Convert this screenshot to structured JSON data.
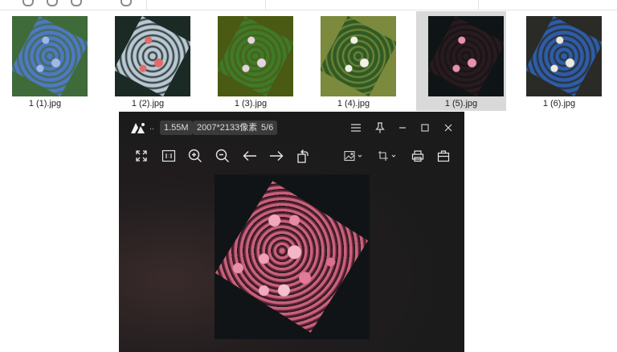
{
  "explorer": {
    "files": [
      {
        "name": "1 (1).jpg",
        "selected": false,
        "colors": [
          "#3f6b3a",
          "#4f78c4",
          "#9fb8e8"
        ]
      },
      {
        "name": "1 (2).jpg",
        "selected": false,
        "colors": [
          "#1c2a26",
          "#b9c8d3",
          "#e46b6b"
        ]
      },
      {
        "name": "1 (3).jpg",
        "selected": false,
        "colors": [
          "#4a5a12",
          "#3f7a2a",
          "#e8d3e0"
        ]
      },
      {
        "name": "1 (4).jpg",
        "selected": false,
        "colors": [
          "#7b8a3c",
          "#2f5a23",
          "#f2f2e8"
        ]
      },
      {
        "name": "1 (5).jpg",
        "selected": true,
        "colors": [
          "#0f1416",
          "#2a1a1e",
          "#e891ad"
        ]
      },
      {
        "name": "1 (6).jpg",
        "selected": false,
        "colors": [
          "#2a2a26",
          "#2e5da8",
          "#f0eadc"
        ]
      }
    ]
  },
  "viewer": {
    "ellipsis": "..",
    "file_size": "1.55M",
    "dimensions": "2007*2133像素",
    "position": "5/6",
    "window_buttons": [
      "menu-icon",
      "pin-icon",
      "minimize-icon",
      "maximize-icon",
      "close-icon"
    ],
    "tools": [
      "fullscreen-icon",
      "actual-size-icon",
      "zoom-in-icon",
      "zoom-out-icon",
      "previous-icon",
      "next-icon",
      "rotate-icon",
      "image-options-icon",
      "crop-icon",
      "print-icon",
      "bag-icon"
    ]
  }
}
